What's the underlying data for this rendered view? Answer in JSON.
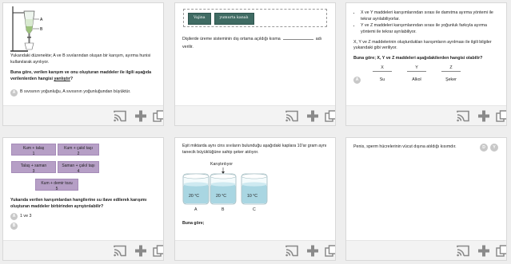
{
  "footer": {
    "cast_icon": "cast-icon",
    "add_icon": "plus-icon",
    "copy_icon": "copy-icon"
  },
  "card1": {
    "diagram_label_a": "A",
    "diagram_label_b": "B",
    "intro": "Yukarıdaki düzenekte; A ve B sıvılarından oluşan bir karışım, ayırma hunisi kullanılarak ayrılıyor.",
    "question_main": "Buna göre, verilen karışım ve onu oluşturan maddeler ile ilgili aşağıda verilenlerden hangisi",
    "question_emph": "yanlıştır",
    "question_end": "?",
    "option_a_letter": "A",
    "option_a_text": "B sıvısının yoğunluğu, A sıvısının yoğunluğundan büyüktür."
  },
  "card2": {
    "btn1": "Vajina",
    "btn2": "yumurta kanalı",
    "sentence_before": "Dişilerde üreme sisteminin dış ortama açıldığı kısma",
    "sentence_after": "adı verilir."
  },
  "card3": {
    "bullet1": "X ve Y maddeleri karışımlarından sırası ile damıtma ayırma yöntemi ile tekrar ayrılabiliyorlar.",
    "bullet2": "Y ve Z maddeleri karışımlarından sırası ile yoğunluk farkıyla ayırma yöntemi ile tekrar ayrılabiliyor.",
    "info": "X, Y ve Z maddelerinin oluşturdukları karışımların ayrılması ile ilgili bilgiler yukarıdaki gibi veriliyor.",
    "question": "Buna göre; X, Y ve Z maddeleri aşağıdakilerden hangisi olabilir?",
    "col_x": "X",
    "col_y": "Y",
    "col_z": "Z",
    "option_a_letter": "A",
    "row_a": [
      "Su",
      "Alkol",
      "Şeker"
    ]
  },
  "card4": {
    "tiles": [
      {
        "line1": "Kum + talaş",
        "line2": "1"
      },
      {
        "line1": "Kum + çakıl taşı",
        "line2": "2"
      },
      {
        "line1": "Talaş + saman",
        "line2": "3"
      },
      {
        "line1": "Saman + çakıl taşı",
        "line2": "4"
      },
      {
        "line1": "Kum + demir tozu",
        "line2": "5"
      }
    ],
    "question": "Yukarıda verilen karışımlardan hangilerine su ilave edilerek karışımı oluşturan maddeler birbirinden ayrıştırılabilir?",
    "option_a_letter": "A",
    "option_a_text": "1 ve 3",
    "option_b_letter": "B"
  },
  "card5": {
    "intro": "Eşit miktarda aynı cins sıvıların bulunduğu aşağıdaki kaplara 10'ar gram aynı tanecik büyüklüğüne sahip şeker atılıyor.",
    "stir_label": "Karıştırılıyor",
    "beakers": [
      {
        "temp": "20 °C",
        "label": "A"
      },
      {
        "temp": "20 °C",
        "label": "B"
      },
      {
        "temp": "10 °C",
        "label": "C"
      }
    ],
    "question": "Buna göre;"
  },
  "card6": {
    "question": "Penis, sperm hücrelerinin vücut dışına atıldığı kısımdır.",
    "badge_d": "D",
    "badge_y": "Y"
  }
}
